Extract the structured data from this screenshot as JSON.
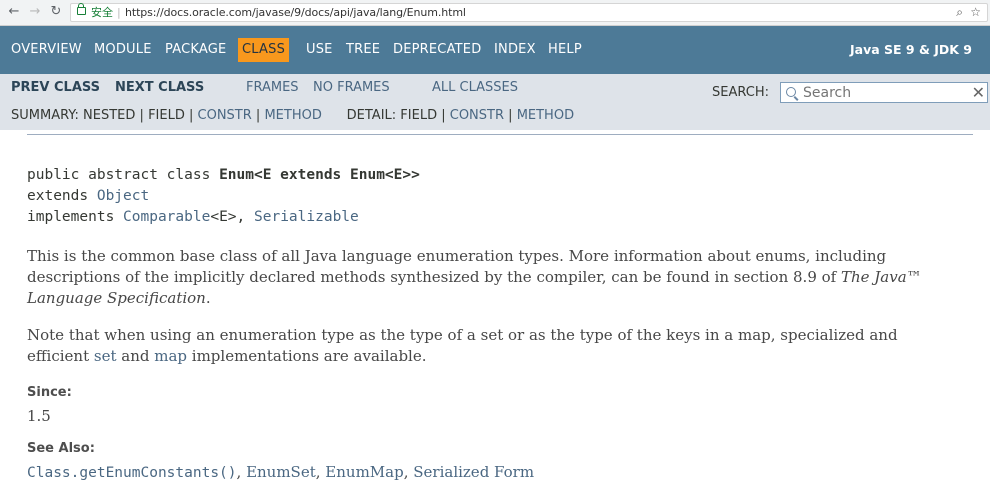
{
  "browser": {
    "back_icon": "back-arrow-icon",
    "forward_icon": "forward-arrow-icon",
    "reload_icon": "reload-icon",
    "secure_label": "安全",
    "url": "https://docs.oracle.com/javase/9/docs/api/java/lang/Enum.html"
  },
  "topnav": {
    "items": [
      "OVERVIEW",
      "MODULE",
      "PACKAGE",
      "CLASS",
      "USE",
      "TREE",
      "DEPRECATED",
      "INDEX",
      "HELP"
    ],
    "active": "CLASS",
    "title": "Java SE 9 & JDK 9",
    "bg_color": "#4d7a97",
    "active_color": "#f8981d"
  },
  "subnav": {
    "prev_class": "PREV CLASS",
    "next_class": "NEXT CLASS",
    "frames": "FRAMES",
    "no_frames": "NO FRAMES",
    "all_classes": "ALL CLASSES",
    "search_label": "SEARCH:",
    "search_placeholder": "Search",
    "summary_label": "SUMMARY:",
    "summary_nested": "NESTED",
    "summary_field": "FIELD",
    "summary_constr": "CONSTR",
    "summary_method": "METHOD",
    "detail_label": "DETAIL:",
    "detail_field": "FIELD",
    "detail_constr": "CONSTR",
    "detail_method": "METHOD",
    "sep": "|"
  },
  "signature": {
    "line1_prefix": "public abstract class ",
    "line1_name": "Enum<E extends Enum<E>>",
    "line2_prefix": "extends ",
    "line2_link": "Object",
    "line3_prefix": "implements ",
    "line3_link1": "Comparable",
    "line3_mid": "<E>, ",
    "line3_link2": "Serializable"
  },
  "description": {
    "p1_text": "This is the common base class of all Java language enumeration types. More information about enums, including descriptions of the implicitly declared methods synthesized by the compiler, can be found in section 8.9 of ",
    "p1_italic": "The Java™ Language Specification",
    "p1_end": ".",
    "p2_start": "Note that when using an enumeration type as the type of a set or as the type of the keys in a map, specialized and efficient ",
    "p2_link1": "set",
    "p2_mid": " and ",
    "p2_link2": "map",
    "p2_end": " implementations are available."
  },
  "since": {
    "label": "Since:",
    "value": "1.5"
  },
  "see_also": {
    "label": "See Also:",
    "link1": "Class.getEnumConstants()",
    "link2": "EnumSet",
    "link3": "EnumMap",
    "link4": "Serialized Form",
    "sep": ", "
  }
}
